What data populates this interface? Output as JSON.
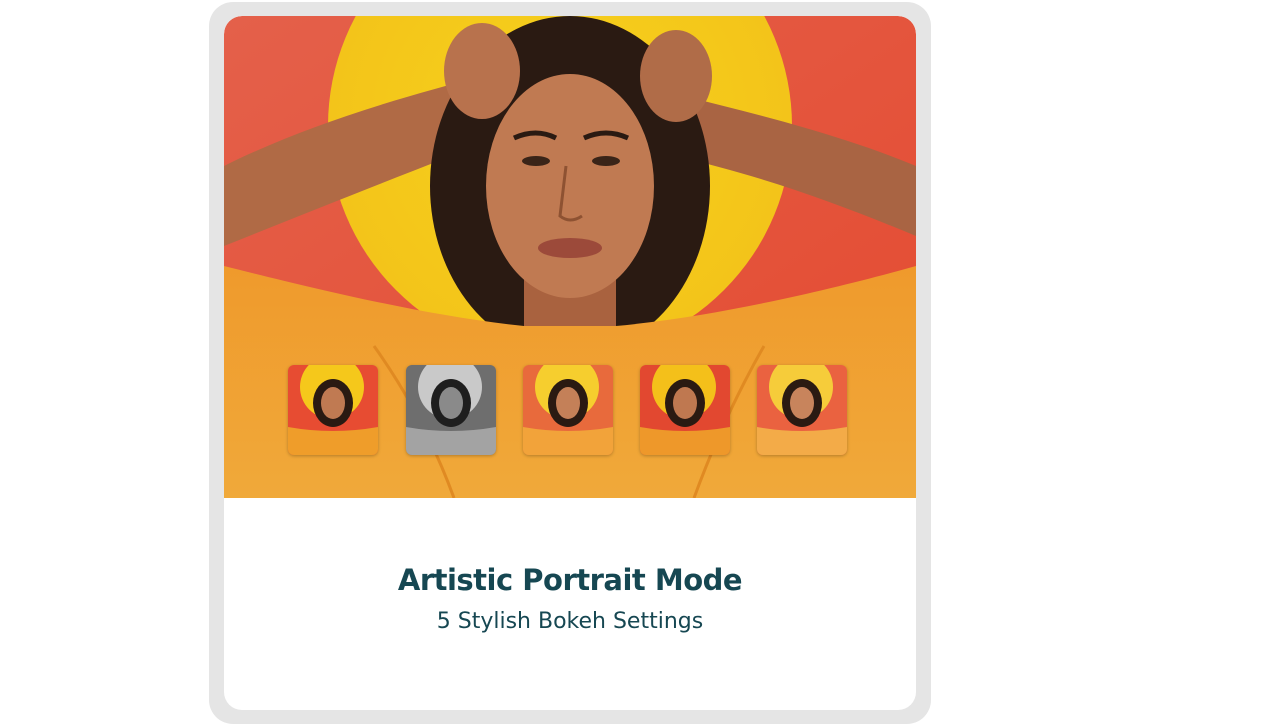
{
  "card": {
    "title": "Artistic Portrait Mode",
    "subtitle": "5 Stylish Bokeh Settings"
  },
  "hero_image": {
    "subject": "portrait-photo",
    "colors": {
      "wall": "#e8533a",
      "sun": "#f5c81b",
      "shirt": "#ef9d2a",
      "skin": "#b9714c",
      "hair": "#2a1a12"
    }
  },
  "bokeh_thumbnails": [
    {
      "style": "color-vivid"
    },
    {
      "style": "monochrome"
    },
    {
      "style": "warm"
    },
    {
      "style": "red-tone"
    },
    {
      "style": "soft-warm"
    }
  ],
  "colors": {
    "title_text": "#164752",
    "frame_border": "#e5e5e5"
  }
}
